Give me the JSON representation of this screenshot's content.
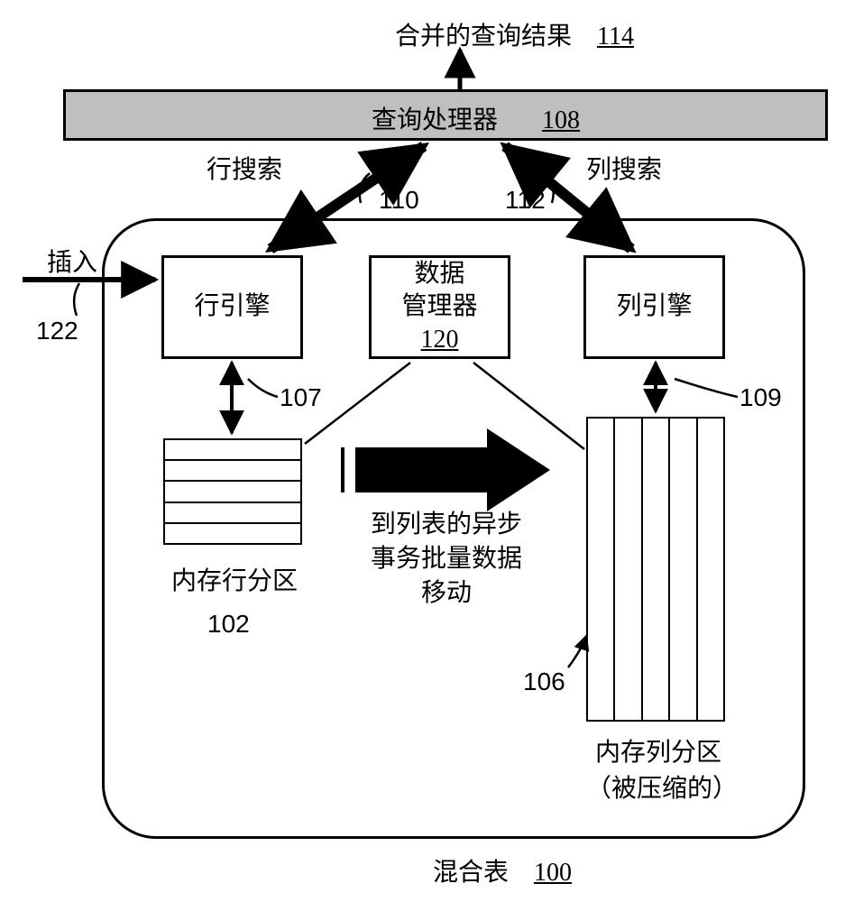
{
  "top_result": {
    "text": "合并的查询结果",
    "ref": "114"
  },
  "query_processor": {
    "text": "查询处理器",
    "ref": "108"
  },
  "row_search": {
    "text": "行搜索",
    "ref": "110"
  },
  "col_search": {
    "text": "列搜索",
    "ref": "112"
  },
  "insert": {
    "text": "插入",
    "ref": "122"
  },
  "row_engine": {
    "text": "行引擎"
  },
  "col_engine": {
    "text": "列引擎"
  },
  "data_manager": {
    "line1": "数据",
    "line2": "管理器",
    "ref": "120"
  },
  "row_engine_link": {
    "ref": "107"
  },
  "col_engine_link": {
    "ref": "109"
  },
  "row_partition": {
    "text": "内存行分区",
    "ref": "102"
  },
  "col_partition": {
    "line1": "内存列分区",
    "line2": "（被压缩的）",
    "ref": "106"
  },
  "async_move": {
    "line1": "到列表的异步",
    "line2": "事务批量数据",
    "line3": "移动"
  },
  "hybrid_table": {
    "text": "混合表",
    "ref": "100"
  }
}
